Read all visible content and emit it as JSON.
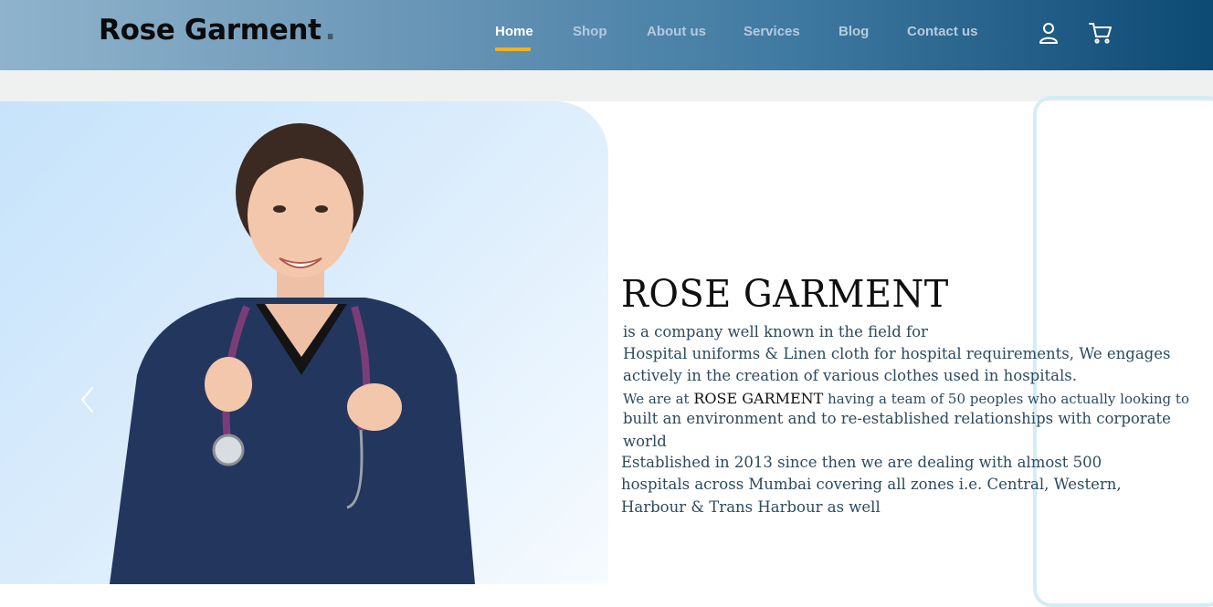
{
  "header": {
    "logo": "Rose Garment",
    "logo_dot": ".",
    "nav": [
      {
        "label": "Home",
        "active": true
      },
      {
        "label": "Shop",
        "active": false
      },
      {
        "label": "About us",
        "active": false
      },
      {
        "label": "Services",
        "active": false
      },
      {
        "label": "Blog",
        "active": false
      },
      {
        "label": "Contact us",
        "active": false
      }
    ],
    "icons": [
      "user-icon",
      "cart-icon"
    ],
    "accent_color": "#f2b21c"
  },
  "hero": {
    "image_desc_icon": "nurse-photo",
    "prev_icon": "chevron-left-icon",
    "title": "ROSE GARMENT",
    "lines": [
      "is a company well known in the field for",
      "Hospital uniforms & Linen cloth for hospital requirements, We engages",
      "actively in the creation of  various clothes used in hospitals.",
      "We are at ",
      "ROSE GARMENT",
      " having a team of 50 peoples who actually looking to",
      "built an environment and to re-established relationships with corporate",
      "world",
      "Established in 2013 since then we are dealing with  almost  500",
      "hospitals across Mumbai covering all zones i.e. Central, Western,",
      "Harbour & Trans Harbour as well"
    ]
  }
}
